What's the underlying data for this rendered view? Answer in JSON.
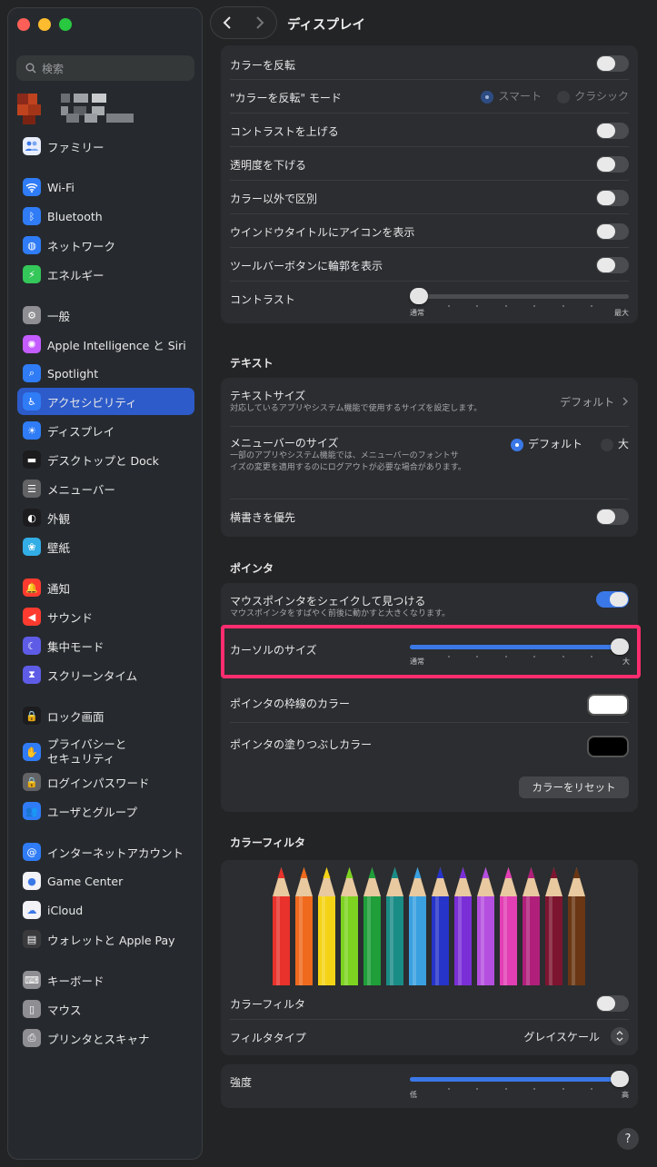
{
  "window": {
    "title": "ディスプレイ",
    "traffic_colors": [
      "#ff5f57",
      "#febc2e",
      "#28c840"
    ]
  },
  "search": {
    "placeholder": "検索"
  },
  "sidebar": {
    "family": "ファミリー",
    "items": [
      {
        "label": "Wi-Fi",
        "icon": "wifi-icon",
        "color": "#2f7cf6"
      },
      {
        "label": "Bluetooth",
        "icon": "bluetooth-icon",
        "color": "#2f7cf6"
      },
      {
        "label": "ネットワーク",
        "icon": "globe-icon",
        "color": "#2f7cf6"
      },
      {
        "label": "エネルギー",
        "icon": "battery-icon",
        "color": "#34c759"
      },
      {
        "label": "一般",
        "icon": "gear-icon",
        "color": "#8e8e93"
      },
      {
        "label": "Apple Intelligence と Siri",
        "icon": "siri-icon",
        "color": "#c45cff"
      },
      {
        "label": "Spotlight",
        "icon": "magnifier-icon",
        "color": "#2f7cf6"
      },
      {
        "label": "アクセシビリティ",
        "icon": "accessibility-icon",
        "color": "#2f7cf6"
      },
      {
        "label": "ディスプレイ",
        "icon": "sun-icon",
        "color": "#2f7cf6"
      },
      {
        "label": "デスクトップと Dock",
        "icon": "dock-icon",
        "color": "#1c1c1e"
      },
      {
        "label": "メニューバー",
        "icon": "menubar-icon",
        "color": "#636366"
      },
      {
        "label": "外観",
        "icon": "appearance-icon",
        "color": "#1c1c1e"
      },
      {
        "label": "壁紙",
        "icon": "flower-icon",
        "color": "#32ade6"
      },
      {
        "label": "通知",
        "icon": "bell-icon",
        "color": "#ff3b30"
      },
      {
        "label": "サウンド",
        "icon": "speaker-icon",
        "color": "#ff3b30"
      },
      {
        "label": "集中モード",
        "icon": "moon-icon",
        "color": "#5e5ce6"
      },
      {
        "label": "スクリーンタイム",
        "icon": "hourglass-icon",
        "color": "#5e5ce6"
      },
      {
        "label": "ロック画面",
        "icon": "lock-screen-icon",
        "color": "#1c1c1e"
      },
      {
        "label": "プライバシーと\nセキュリティ",
        "icon": "hand-icon",
        "color": "#2f7cf6"
      },
      {
        "label": "ログインパスワード",
        "icon": "lock-icon",
        "color": "#636366"
      },
      {
        "label": "ユーザとグループ",
        "icon": "users-icon",
        "color": "#2f7cf6"
      },
      {
        "label": "インターネットアカウント",
        "icon": "at-icon",
        "color": "#2f7cf6"
      },
      {
        "label": "Game Center",
        "icon": "game-center-icon",
        "color": "#f2f2f7"
      },
      {
        "label": "iCloud",
        "icon": "cloud-icon",
        "color": "#f2f2f7"
      },
      {
        "label": "ウォレットと Apple Pay",
        "icon": "wallet-icon",
        "color": "#3a3a3c"
      },
      {
        "label": "キーボード",
        "icon": "keyboard-icon",
        "color": "#8e8e93"
      },
      {
        "label": "マウス",
        "icon": "mouse-icon",
        "color": "#8e8e93"
      },
      {
        "label": "プリンタとスキャナ",
        "icon": "printer-icon",
        "color": "#8e8e93"
      }
    ]
  },
  "display": {
    "invert": "カラーを反転",
    "invert_mode": "\"カラーを反転\" モード",
    "mode_smart": "スマート",
    "mode_classic": "クラシック",
    "contrast_up": "コントラストを上げる",
    "reduce_trans": "透明度を下げる",
    "diff_color": "カラー以外で区別",
    "window_icons": "ウインドウタイトルにアイコンを表示",
    "toolbar_outline": "ツールバーボタンに輪郭を表示",
    "contrast": "コントラスト",
    "contrast_min": "通常",
    "contrast_max": "最大",
    "contrast_level": 0.0
  },
  "text": {
    "section": "テキスト",
    "size_label": "テキストサイズ",
    "size_desc": "対応しているアプリやシステム機能で使用するサイズを設定します。",
    "size_value": "デフォルト",
    "menubar_size": "メニューバーのサイズ",
    "menubar_desc": "一部のアプリやシステム機能では、メニューバーのフォントサイズの変更を適用するのにログアウトが必要な場合があります。",
    "opt_default": "デフォルト",
    "opt_large": "大",
    "prefer_horizontal": "横書きを優先"
  },
  "pointer": {
    "section": "ポインタ",
    "shake": "マウスポインタをシェイクして見つける",
    "shake_desc": "マウスポインタをすばやく前後に動かすと大きくなります。",
    "cursor_size": "カーソルのサイズ",
    "cursor_min": "通常",
    "cursor_max": "大",
    "cursor_level": 1.0,
    "outline_color": "ポインタの枠線のカラー",
    "fill_color": "ポインタの塗りつぶしカラー",
    "reset": "カラーをリセット",
    "outline_swatch": "#ffffff",
    "fill_swatch": "#000000",
    "highlight_color": "#ff2d6f"
  },
  "filter": {
    "section": "カラーフィルタ",
    "filter_label": "カラーフィルタ",
    "type_label": "フィルタタイプ",
    "type_value": "グレイスケール",
    "intensity": "強度",
    "int_min": "低",
    "int_max": "高",
    "intensity_level": 1.0,
    "pencil_colors": [
      "#e8322b",
      "#f06a1e",
      "#f4d316",
      "#7ed321",
      "#1f9e3a",
      "#1a8c86",
      "#3aa0e0",
      "#2634c9",
      "#7a2fd6",
      "#b54fe0",
      "#e23fb4",
      "#b01f7a",
      "#7d1430",
      "#6a3614"
    ]
  },
  "help": "?"
}
